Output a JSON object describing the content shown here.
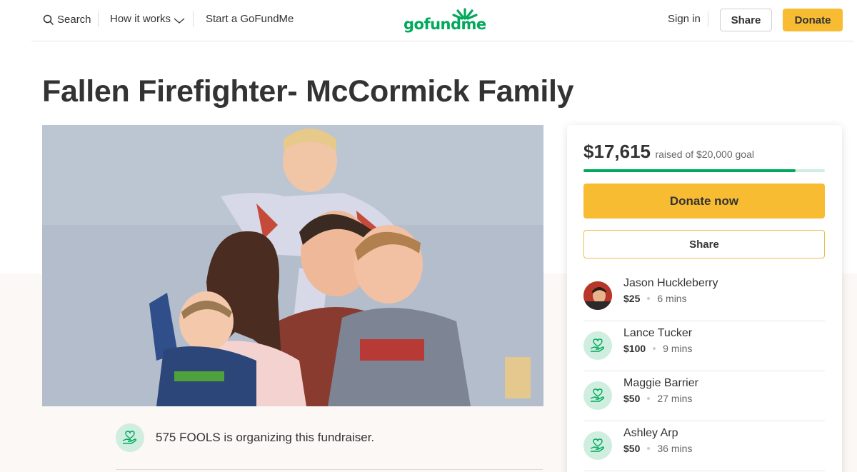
{
  "header": {
    "search_label": "Search",
    "how_label": "How it works",
    "start_label": "Start a GoFundMe",
    "logo_text": "gofundme",
    "signin_label": "Sign in",
    "share_label": "Share",
    "donate_label": "Donate"
  },
  "campaign": {
    "title": "Fallen Firefighter- McCormick Family",
    "organizer_text": "575 FOOLS is organizing this fundraiser."
  },
  "sidebar": {
    "raised_amount": "$17,615",
    "raised_goal": "raised of $20,000 goal",
    "progress_fraction": 0.88,
    "donate_now_label": "Donate now",
    "share_label": "Share",
    "donations": [
      {
        "name": "Jason Huckleberry",
        "amount": "$25",
        "time": "6 mins",
        "avatar": "photo"
      },
      {
        "name": "Lance Tucker",
        "amount": "$100",
        "time": "9 mins",
        "avatar": "heart-hand-icon"
      },
      {
        "name": "Maggie Barrier",
        "amount": "$50",
        "time": "27 mins",
        "avatar": "heart-hand-icon"
      },
      {
        "name": "Ashley Arp",
        "amount": "$50",
        "time": "36 mins",
        "avatar": "heart-hand-icon"
      }
    ]
  },
  "colors": {
    "brand_green": "#02a95c",
    "donate_yellow": "#f8bc33",
    "light_green": "#cfeee0"
  }
}
